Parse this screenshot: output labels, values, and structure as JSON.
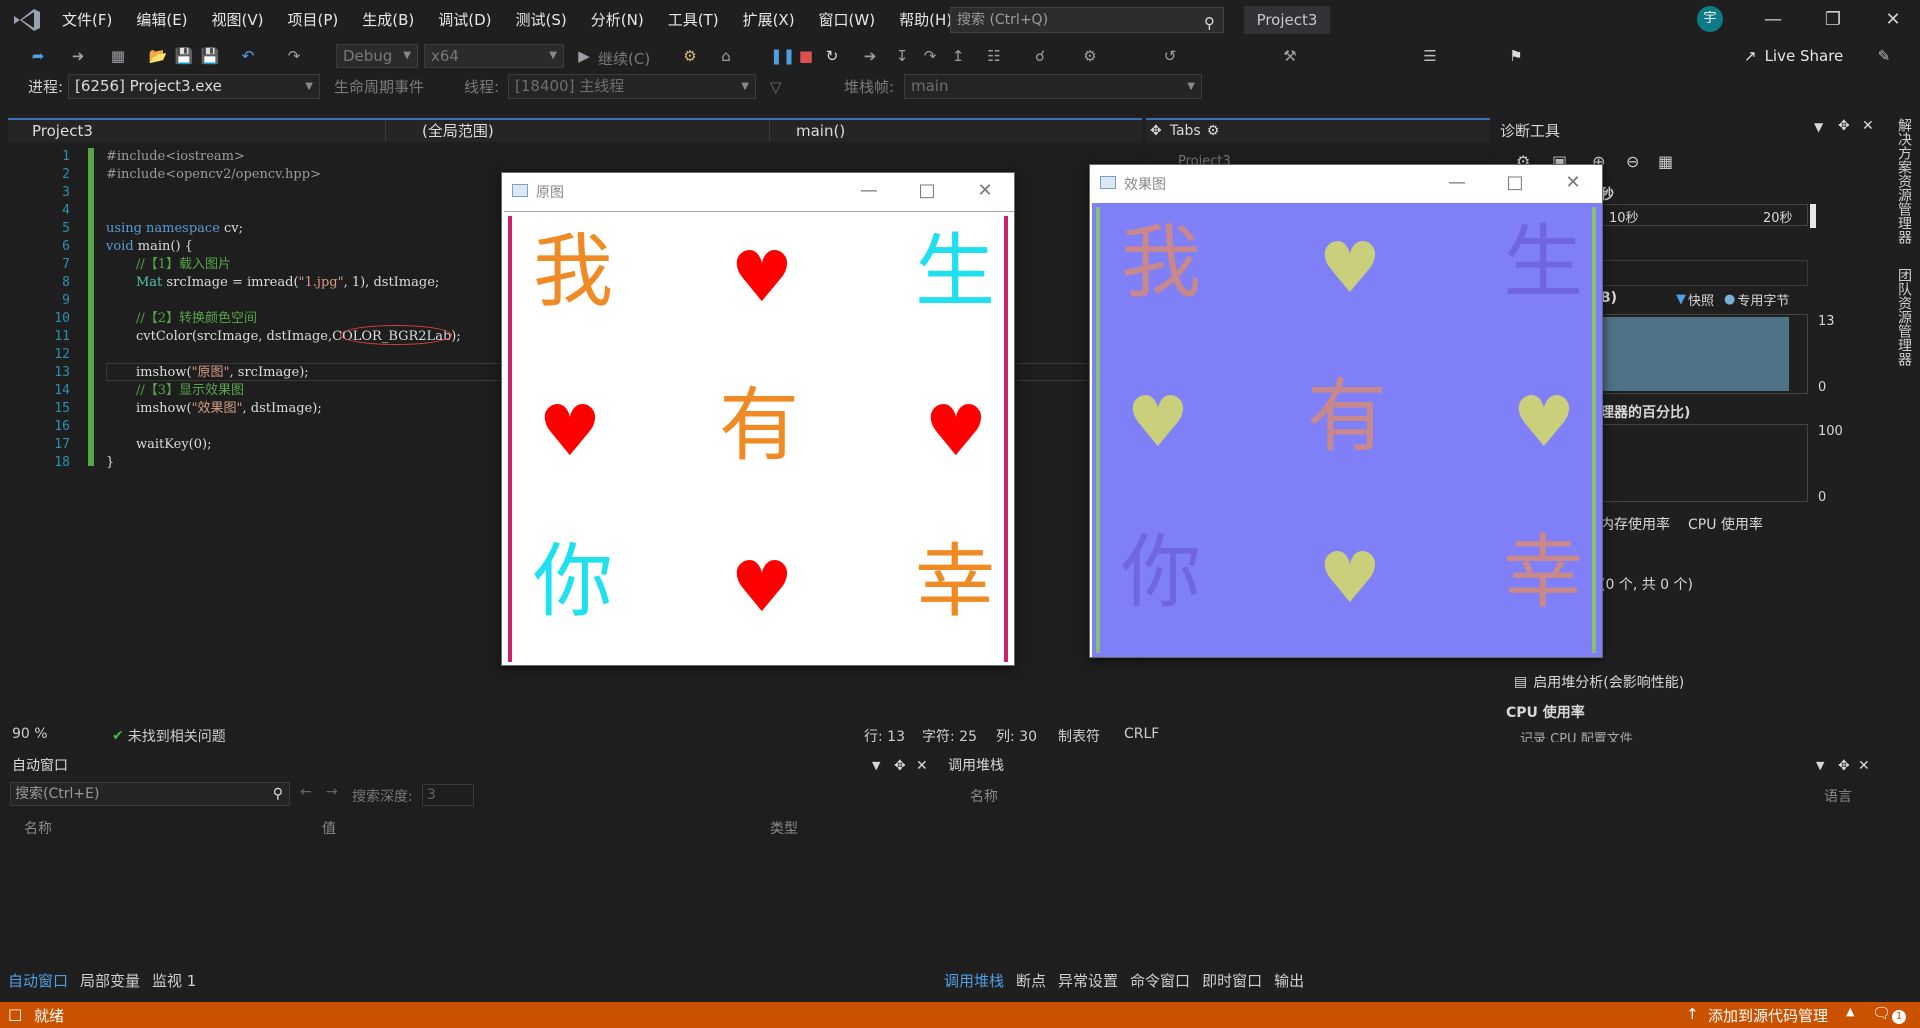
{
  "menu": [
    "文件(F)",
    "编辑(E)",
    "视图(V)",
    "项目(P)",
    "生成(B)",
    "调试(D)",
    "测试(S)",
    "分析(N)",
    "工具(T)",
    "扩展(X)",
    "窗口(W)",
    "帮助(H)"
  ],
  "search": {
    "placeholder": "搜索 (Ctrl+Q)"
  },
  "project_name": "Project3",
  "user_initial": "宇",
  "toolbar": {
    "config": "Debug",
    "platform": "x64",
    "continue_label": "继续(C)",
    "live_share": "Live Share"
  },
  "debug_bar": {
    "process_label": "进程:",
    "process_value": "[6256] Project3.exe",
    "lifecycle": "生命周期事件",
    "thread_label": "线程:",
    "thread_value": "[18400] 主线程",
    "stackframe_label": "堆栈帧:",
    "stackframe_value": "main"
  },
  "editor": {
    "nav_project": "Project3",
    "nav_scope": "(全局范围)",
    "nav_func": "main()",
    "zoom": "90 %",
    "issues": "未找到相关问题",
    "position": {
      "line": "行: 13",
      "char": "字符: 25",
      "col": "列: 30",
      "tabs": "制表符",
      "eol": "CRLF"
    },
    "line_numbers": [
      "1",
      "2",
      "3",
      "4",
      "5",
      "6",
      "7",
      "8",
      "9",
      "10",
      "11",
      "12",
      "13",
      "14",
      "15",
      "16",
      "17",
      "18"
    ]
  },
  "code": {
    "l1": "#include<iostream>",
    "l2": "#include<opencv2/opencv.hpp>",
    "l5a": "using namespace",
    "l5b": " cv;",
    "l6a": "void",
    "l6b": " main() {",
    "l7": "//【1】载入图片",
    "l8a": "Mat",
    "l8b": " srcImage = imread(",
    "l8c": "\"1.jpg\"",
    "l8d": ", 1), dstImage;",
    "l10": "//【2】转换颜色空间",
    "l11a": "cvtColor(srcImage, dstImage,",
    "l11b": "COLOR_BGR2Lab",
    "l11c": ");",
    "l13a": "imshow(",
    "l13b": "\"原图\"",
    "l13c": ", srcImage);",
    "l14": "//【3】显示效果图",
    "l15a": "imshow(",
    "l15b": "\"效果图\"",
    "l15c": ", dstImage);",
    "l17": "waitKey(0);",
    "l18": "}"
  },
  "tabs_panel": {
    "title": "Tabs",
    "item": "Project3"
  },
  "diag": {
    "title": "诊断工具",
    "sec_label": "秒",
    "tick_10": "10秒",
    "tick_20": "20秒",
    "mem_label": "B)",
    "snapshot": "快照",
    "private_bytes": "专用字节",
    "mem_max": "13",
    "mem_min": "0",
    "cpu_label": "理器的百分比)",
    "cpu_max": "100",
    "cpu_min": "0",
    "tab_mem": "内存使用率",
    "tab_cpu": "CPU 使用率",
    "snap_count": "(0 个, 共 0 个)",
    "heap_analysis": "启用堆分析(会影响性能)",
    "cpu_section": "CPU 使用率",
    "cpu_record": "记录 CPU 配置文件"
  },
  "right_rail": {
    "solution_explorer": "解决方案资源管理器",
    "team_explorer": "团队资源管理器"
  },
  "win_orig": {
    "title": "原图",
    "glyphs": [
      "我",
      "有",
      "生",
      "你",
      "幸"
    ]
  },
  "win_effect": {
    "title": "效果图"
  },
  "colors": {
    "orange": "#f08a24",
    "cyan": "#1ee0ee",
    "red": "#ff0000",
    "lab_bg": "#7f7ff8"
  },
  "auto_panel": {
    "title": "自动窗口",
    "search_placeholder": "搜索(Ctrl+E)",
    "depth_label": "搜索深度:",
    "depth_value": "3",
    "col_name": "名称",
    "col_value": "值",
    "col_type": "类型"
  },
  "callstack_panel": {
    "title": "调用堆栈",
    "col_name": "名称",
    "col_lang": "语言"
  },
  "bottom_tabs_left": [
    "自动窗口",
    "局部变量",
    "监视 1"
  ],
  "bottom_tabs_right": [
    "调用堆栈",
    "断点",
    "异常设置",
    "命令窗口",
    "即时窗口",
    "输出"
  ],
  "status": {
    "ready": "就绪",
    "source_control": "添加到源代码管理",
    "notifications": "1"
  }
}
